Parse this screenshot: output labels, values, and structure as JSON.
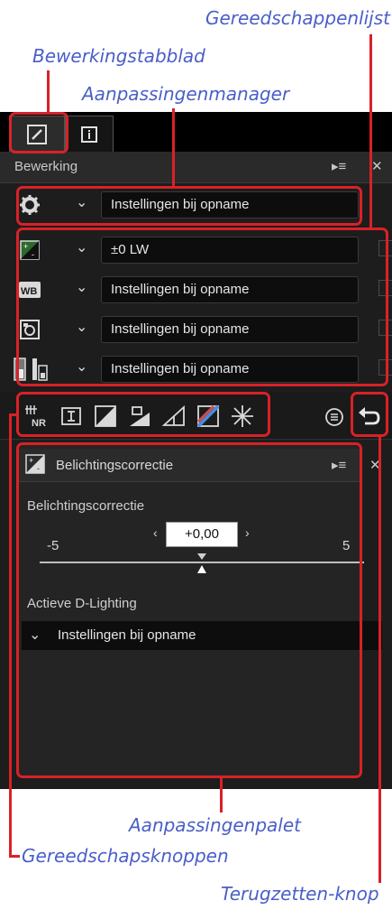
{
  "callouts": {
    "toolbox_list": "Gereedschappenlijst",
    "edit_tab": "Bewerkingstabblad",
    "adjustment_manager": "Aanpassingenmanager",
    "adjustment_palette": "Aanpassingenpalet",
    "tool_buttons": "Gereedschapsknoppen",
    "reset_button": "Terugzetten-knop"
  },
  "panel": {
    "header_title": "Bewerking",
    "menu_icon": "list-menu-icon",
    "close_icon": "close-icon"
  },
  "manager": {
    "icon": "gear-icon",
    "value": "Instellingen bij opname"
  },
  "rows": [
    {
      "icon": "exposure-icon",
      "value": "±0 LW"
    },
    {
      "icon": "white-balance-icon",
      "value": "Instellingen bij opname"
    },
    {
      "icon": "picture-control-icon",
      "value": "Instellingen bij opname"
    },
    {
      "icon": "tone-icon",
      "value": "Instellingen bij opname"
    }
  ],
  "tools": [
    "noise-reduction-icon",
    "crop-icon",
    "levels-icon",
    "camera-adjust-icon",
    "perspective-icon",
    "color-icon",
    "sparkle-icon",
    "history-icon",
    "reset-icon"
  ],
  "palette": {
    "title": "Belichtingscorrectie",
    "section1": "Belichtingscorrectie",
    "value": "+0,00",
    "min": "-5",
    "max": "5",
    "slider_position": 0.5,
    "section2": "Actieve D-Lighting",
    "adl_value": "Instellingen bij opname"
  },
  "colors": {
    "accent": "#d92128",
    "callout": "#4a5ec8"
  }
}
